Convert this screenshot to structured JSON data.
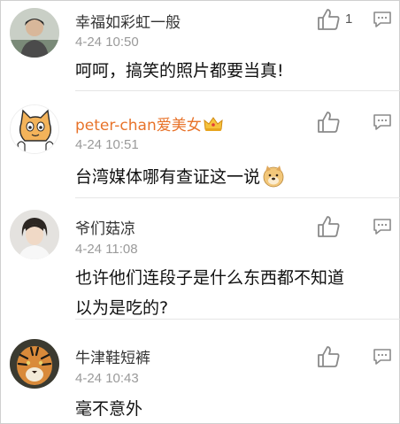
{
  "comments": [
    {
      "username": "幸福如彩虹一般",
      "time": "4-24 10:50",
      "text": "呵呵，搞笑的照片都要当真!",
      "likes": "1",
      "avatar": "photo-avatar"
    },
    {
      "username": "peter-chan爱美女",
      "time": "4-24 10:51",
      "text": "台湾媒体哪有查证这一说",
      "likes": "",
      "avatar": "cat-cartoon-avatar",
      "badge": "crown-vip-icon",
      "emoji": "doge-emoji"
    },
    {
      "username": "爷们菇凉",
      "time": "4-24 11:08",
      "text_line1": "也许他们连段子是什么东西都不知道",
      "text_line2": "以为是吃的?",
      "likes": "",
      "avatar": "girl-photo-avatar"
    },
    {
      "username": "牛津鞋短裤",
      "time": "4-24 10:43",
      "text": "毫不意外",
      "likes": "",
      "avatar": "tiger-avatar"
    }
  ],
  "colors": {
    "vip_name": "#e8732a",
    "time": "#9a9a9a",
    "icon": "#8a8a8a"
  }
}
